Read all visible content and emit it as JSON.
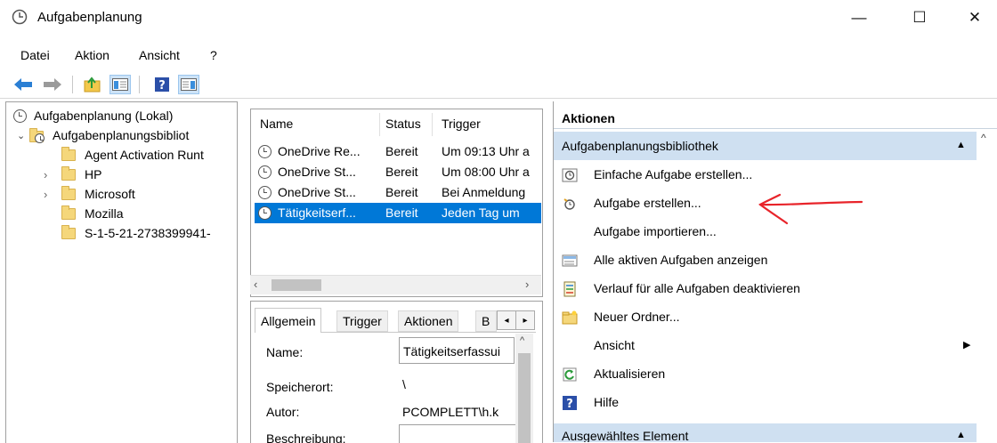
{
  "window": {
    "title": "Aufgabenplanung",
    "minimize": "—",
    "maximize": "☐",
    "close": "✕"
  },
  "menu": [
    "Datei",
    "Aktion",
    "Ansicht",
    "?"
  ],
  "tree": {
    "root": "Aufgabenplanung (Lokal)",
    "library": "Aufgabenplanungsbibliot",
    "children": [
      "Agent Activation Runt",
      "HP",
      "Microsoft",
      "Mozilla",
      "S-1-5-21-2738399941-"
    ]
  },
  "task_list": {
    "columns": [
      "Name",
      "Status",
      "Trigger"
    ],
    "rows": [
      {
        "name": "OneDrive Re...",
        "status": "Bereit",
        "trigger": "Um 09:13 Uhr a"
      },
      {
        "name": "OneDrive St...",
        "status": "Bereit",
        "trigger": "Um 08:00 Uhr a"
      },
      {
        "name": "OneDrive St...",
        "status": "Bereit",
        "trigger": "Bei Anmeldung"
      },
      {
        "name": "Tätigkeitserf...",
        "status": "Bereit",
        "trigger": "Jeden Tag um"
      }
    ]
  },
  "details": {
    "tabs": [
      "Allgemein",
      "Trigger",
      "Aktionen",
      "B"
    ],
    "fields": [
      {
        "label": "Name:",
        "value": "Tätigkeitserfassui"
      },
      {
        "label": "Speicherort:",
        "value": "\\"
      },
      {
        "label": "Autor:",
        "value": "PCOMPLETT\\h.k"
      },
      {
        "label": "Beschreibung:",
        "value": ""
      }
    ]
  },
  "actions": {
    "header": "Aktionen",
    "section1": "Aufgabenplanungsbibliothek",
    "items": [
      "Einfache Aufgabe erstellen...",
      "Aufgabe erstellen...",
      "Aufgabe importieren...",
      "Alle aktiven Aufgaben anzeigen",
      "Verlauf für alle Aufgaben deaktivieren",
      "Neuer Ordner...",
      "Ansicht",
      "Aktualisieren",
      "Hilfe"
    ],
    "section2": "Ausgewähltes Element"
  },
  "colors": {
    "selection": "#0078d7",
    "section_header": "#cfe0f1",
    "annotation_arrow": "#e8242a"
  }
}
